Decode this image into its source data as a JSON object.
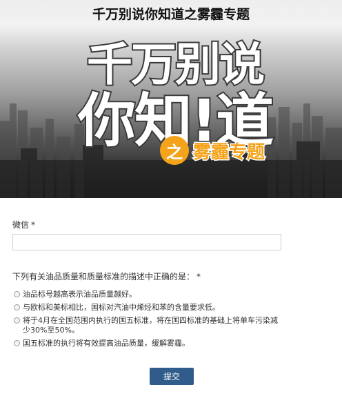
{
  "banner": {
    "title": "千万别说你知道之雾霾专题",
    "big_line_1": "千万别说",
    "big_line_2": "你知!道",
    "badge_char": "之",
    "badge_text": "雾霾专题",
    "badge_color": "#f5a31a"
  },
  "form": {
    "wechat_label": "微信",
    "required_mark": "*",
    "wechat_value": "",
    "question": "下列有关油品质量和质量标准的描述中正确的是：",
    "options": [
      "油品标号越高表示油品质量越好。",
      "与欧标和美标相比，国标对汽油中烯烃和苯的含量要求低。",
      "将于4月在全国范围内执行的国五标准，将在国四标准的基础上将单车污染减少30%至50%。",
      "国五标准的执行将有效提高油品质量，缓解雾霾。"
    ],
    "submit_label": "提交",
    "submit_color": "#2f5c8a"
  }
}
